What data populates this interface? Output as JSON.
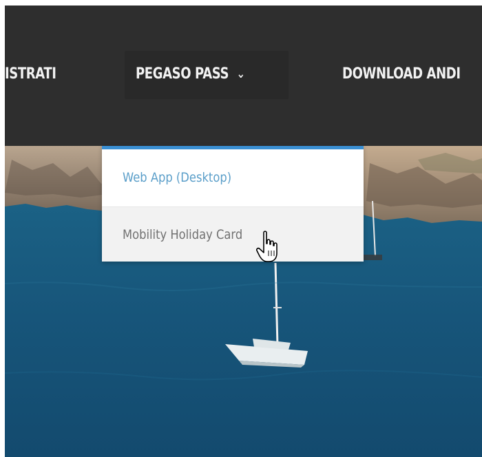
{
  "nav": {
    "items": [
      {
        "label": "ISTRATI"
      },
      {
        "label": "PEGASO PASS",
        "chevron": "⌄"
      },
      {
        "label": "DOWNLOAD ANDI"
      }
    ]
  },
  "dropdown": {
    "accent": "#3a8fd3",
    "items": [
      {
        "label": "Web App (Desktop)"
      },
      {
        "label": "Mobility Holiday Card"
      }
    ]
  },
  "cursor": {
    "icon": "hand-pointer-icon"
  }
}
